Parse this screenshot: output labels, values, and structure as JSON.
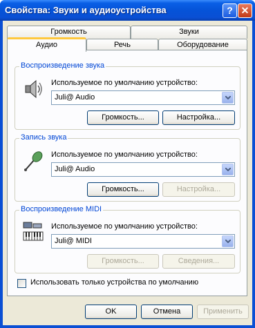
{
  "window": {
    "title": "Свойства: Звуки и аудиоустройства",
    "help": "?",
    "close": "✕"
  },
  "tabs": {
    "row1": [
      "Громкость",
      "Звуки"
    ],
    "row2": [
      "Аудио",
      "Речь",
      "Оборудование"
    ]
  },
  "playback": {
    "title": "Воспроизведение звука",
    "label": "Используемое по умолчанию устройство:",
    "value": "Juli@ Audio",
    "btn_volume": "Громкость...",
    "btn_settings": "Настройка..."
  },
  "record": {
    "title": "Запись звука",
    "label": "Используемое по умолчанию устройство:",
    "value": "Juli@ Audio",
    "btn_volume": "Громкость...",
    "btn_settings": "Настройка..."
  },
  "midi": {
    "title": "Воспроизведение MIDI",
    "label": "Используемое по умолчанию устройство:",
    "value": "Juli@ MIDI",
    "btn_volume": "Громкость...",
    "btn_info": "Сведения..."
  },
  "default_only": "Использовать только устройства по умолчанию",
  "footer": {
    "ok": "OK",
    "cancel": "Отмена",
    "apply": "Применить"
  }
}
